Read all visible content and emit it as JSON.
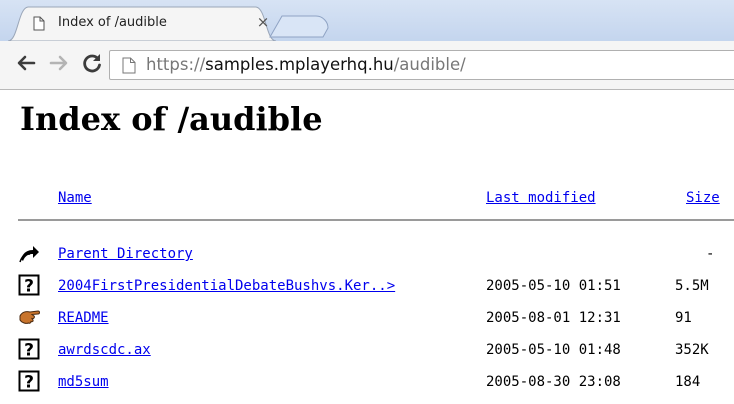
{
  "browser": {
    "tab": {
      "title": "Index of /audible",
      "close_glyph": "×",
      "favicon": "page-icon"
    },
    "url": {
      "scheme": "https://",
      "host": "samples.mplayerhq.hu",
      "path": "/audible/"
    }
  },
  "page": {
    "title": "Index of /audible",
    "columns": {
      "name": "Name",
      "last_modified": "Last modified",
      "size": "Size"
    },
    "rows": [
      {
        "icon": "back-arrow-icon",
        "name": "Parent Directory",
        "date": "",
        "size": "-",
        "visited": true
      },
      {
        "icon": "unknown-file-icon",
        "name": "2004FirstPresidentialDebateBushvs.Ker..>",
        "date": "2005-05-10 01:51",
        "size": "5.5M",
        "visited": false
      },
      {
        "icon": "pointing-hand-icon",
        "name": "README",
        "date": "2005-08-01 12:31",
        "size": "91",
        "visited": false
      },
      {
        "icon": "unknown-file-icon",
        "name": "awrdscdc.ax",
        "date": "2005-05-10 01:48",
        "size": "352K",
        "visited": false
      },
      {
        "icon": "unknown-file-icon",
        "name": "md5sum",
        "date": "2005-08-30 23:08",
        "size": "184",
        "visited": false
      }
    ]
  }
}
